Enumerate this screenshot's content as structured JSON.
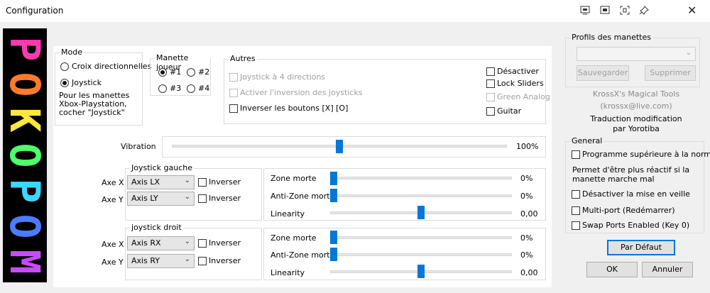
{
  "window": {
    "title": "Configuration"
  },
  "logo": {
    "text": "POKOPOM",
    "colors": [
      "#ff3ab0",
      "#ff7a2a",
      "#ffe83a",
      "#4cff6a",
      "#3ad8ff",
      "#4a7cff",
      "#c84aff"
    ]
  },
  "mode": {
    "title": "Mode",
    "options": [
      "Croix directionnelles",
      "Joystick"
    ],
    "selected": "Joystick",
    "note": "Pour les manettes Xbox-Playstation, cocher \"Joystick\""
  },
  "manette_joueur": {
    "title": "Manette joueur",
    "options": [
      "#1",
      "#2",
      "#3",
      "#4"
    ],
    "selected": "#1"
  },
  "autres": {
    "title": "Autres",
    "joystick_4_directions": "Joystick à 4 directions",
    "activer_inversion": "Activer l'inversion des joysticks",
    "inverser_boutons": "Inverser les boutons [X] [O]",
    "desactiver": "Désactiver",
    "lock_sliders": "Lock Sliders",
    "green_analog": "Green Analog",
    "guitar": "Guitar"
  },
  "vibration": {
    "label": "Vibration",
    "value": "100%",
    "level": 0.5
  },
  "joystick_gauche": {
    "title": "Joystick gauche",
    "axe_x_label": "Axe X",
    "axe_y_label": "Axe Y",
    "axe_x_value": "Axis LX",
    "axe_y_value": "Axis LY",
    "inverser": "Inverser",
    "zone_morte_label": "Zone morte",
    "zone_morte_value": "0%",
    "anti_zone_label": "Anti-Zone morte",
    "anti_zone_value": "0%",
    "linearity_label": "Linearity",
    "linearity_value": "0,00"
  },
  "joystick_droit": {
    "title": "joystick droit",
    "axe_x_label": "Axe X",
    "axe_y_label": "Axe Y",
    "axe_x_value": "Axis RX",
    "axe_y_value": "Axis RY",
    "inverser": "Inverser",
    "zone_morte_label": "Zone morte",
    "zone_morte_value": "0%",
    "anti_zone_label": "Anti-Zone morte",
    "anti_zone_value": "0%",
    "linearity_label": "Linearity",
    "linearity_value": "0,00"
  },
  "profils": {
    "title": "Profils des manettes",
    "sauvegarder": "Sauvegarder",
    "supprimer": "Supprimer",
    "credit1": "KrossX's Magical Tools",
    "credit2": "(krossx@live.com)",
    "translation1": "Traduction  modification",
    "translation2": "par Yorotiba"
  },
  "general": {
    "title": "General",
    "programme_superieure": "Programme supérieure à la normale",
    "permet_note": "Permet d'être plus réactif si la manette marche mal",
    "desactiver_veille": "Désactiver la mise en veille",
    "multi_port": "Multi-port (Redémarrer)",
    "swap_ports": "Swap Ports Enabled (Key 0)"
  },
  "buttons": {
    "par_defaut": "Par Défaut",
    "ok": "OK",
    "annuler": "Annuler"
  }
}
